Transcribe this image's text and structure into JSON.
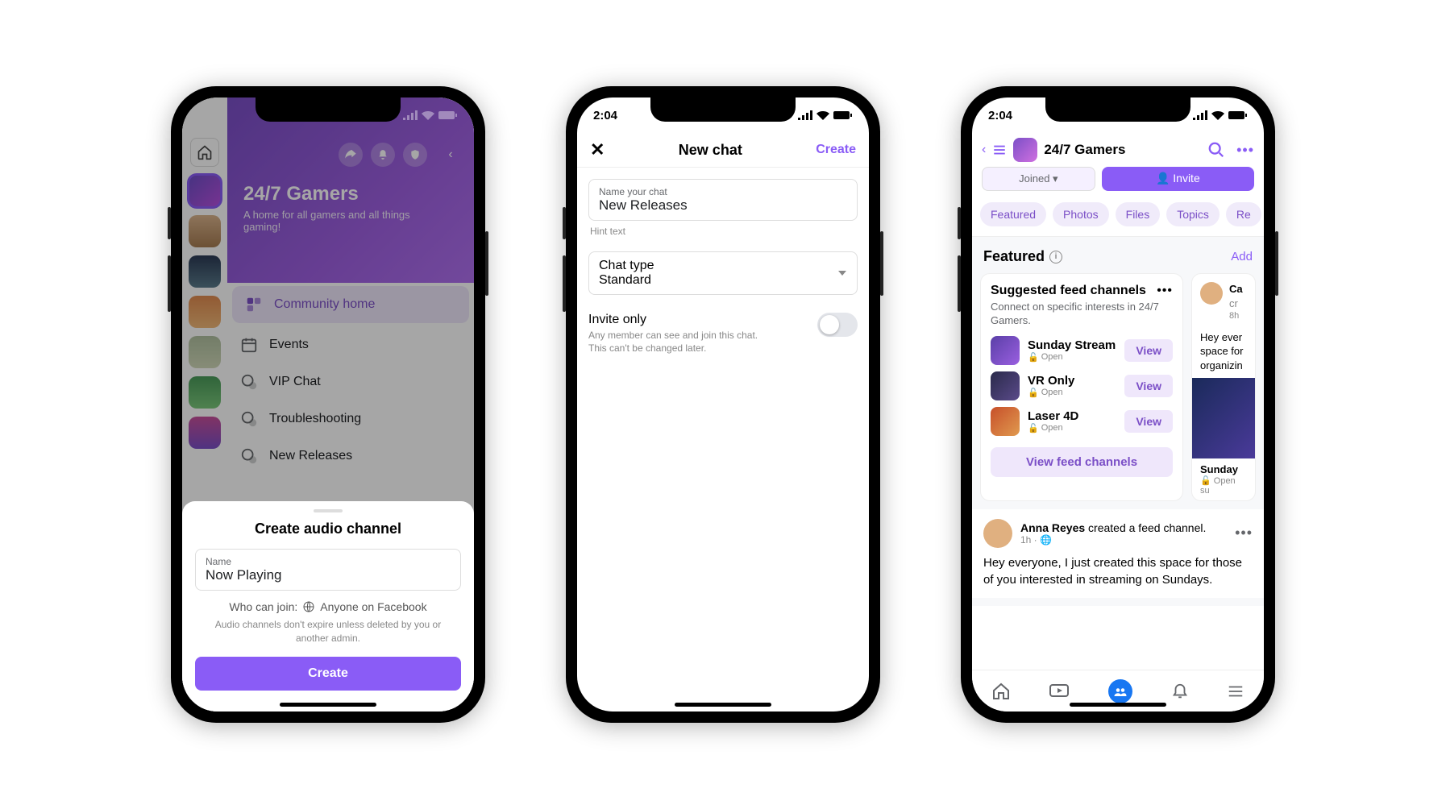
{
  "phone1": {
    "status_time": "",
    "group_title": "24/7 Gamers",
    "group_subtitle": "A home for all gamers and all things gaming!",
    "menu": {
      "community_home": "Community home",
      "events": "Events",
      "vip_chat": "VIP Chat",
      "troubleshooting": "Troubleshooting",
      "new_releases": "New Releases"
    },
    "sheet": {
      "title": "Create audio channel",
      "name_label": "Name",
      "name_value": "Now Playing",
      "who_can_join_label": "Who can join:",
      "who_can_join_value": "Anyone on Facebook",
      "hint": "Audio channels don't expire unless deleted by you or another admin.",
      "create_button": "Create"
    }
  },
  "phone2": {
    "status_time": "2:04",
    "header": {
      "title": "New chat",
      "create": "Create"
    },
    "name_label": "Name your chat",
    "name_value": "New Releases",
    "hint_text": "Hint text",
    "chat_type_label": "Chat type",
    "chat_type_value": "Standard",
    "invite_title": "Invite only",
    "invite_sub": "Any member can see and join this chat. This can't be changed later."
  },
  "phone3": {
    "status_time": "2:04",
    "header_title": "24/7 Gamers",
    "joined_label": "Joined",
    "invite_label": "Invite",
    "tabs": [
      "Featured",
      "Photos",
      "Files",
      "Topics",
      "Re"
    ],
    "featured_label": "Featured",
    "add_label": "Add",
    "suggest_card": {
      "title": "Suggested feed channels",
      "subtitle": "Connect on specific interests in 24/7 Gamers.",
      "channels": [
        {
          "name": "Sunday Stream",
          "status": "Open"
        },
        {
          "name": "VR Only",
          "status": "Open"
        },
        {
          "name": "Laser 4D",
          "status": "Open"
        }
      ],
      "view_btn": "View",
      "view_all": "View feed channels"
    },
    "peek_card": {
      "name": "Ca",
      "line2": "cr",
      "time": "8h",
      "text1": "Hey ever",
      "text2": "space for",
      "text3": "organizin",
      "footer_title": "Sunday",
      "footer_status": "Open su"
    },
    "post": {
      "author": "Anna Reyes",
      "action": "created a feed channel.",
      "meta": "1h · ",
      "text": "Hey everyone, I just created this space for those of you interested in streaming on Sundays."
    }
  }
}
